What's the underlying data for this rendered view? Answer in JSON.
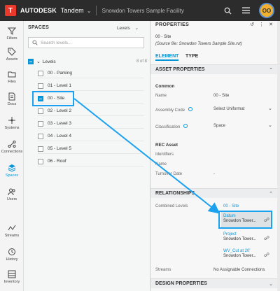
{
  "header": {
    "logo_letter": "T",
    "brand": "AUTODESK",
    "product": "Tandem",
    "facility": "Snowdon Towers Sample Facility",
    "avatar_initials": "OO",
    "icons": [
      "search-icon",
      "menu-icon"
    ]
  },
  "rail": {
    "items": [
      {
        "label": "Filters",
        "icon": "filter-icon"
      },
      {
        "label": "Assets",
        "icon": "tag-icon"
      },
      {
        "label": "Files",
        "icon": "file-icon"
      },
      {
        "label": "Docs",
        "icon": "document-icon"
      },
      {
        "label": "Systems",
        "icon": "systems-icon"
      },
      {
        "label": "Connections",
        "icon": "connections-icon"
      },
      {
        "label": "Spaces",
        "icon": "spaces-icon"
      },
      {
        "label": "Users",
        "icon": "users-icon"
      },
      {
        "label": "Streams",
        "icon": "streams-icon"
      },
      {
        "label": "History",
        "icon": "history-icon"
      },
      {
        "label": "Inventory",
        "icon": "inventory-icon"
      }
    ]
  },
  "spaces": {
    "title": "SPACES",
    "filter_label": "Levels",
    "search_placeholder": "Search levels...",
    "levels_header": "Levels",
    "levels_count": "8 of 8",
    "levels": [
      "00 - Parking",
      "01 - Level 1",
      "00 - Site",
      "02 - Level 2",
      "03 - Level 3",
      "04 - Level 4",
      "05 - Level 5",
      "06 - Roof"
    ]
  },
  "properties": {
    "title": "PROPERTIES",
    "name": "00 - Site",
    "source": "(Source file: Snowdon Towers Sample Site.rvt)",
    "tabs": [
      "ELEMENT",
      "TYPE"
    ],
    "asset_section": "ASSET PROPERTIES",
    "common_group": "Common",
    "name_label": "Name",
    "name_value": "00 - Site",
    "assembly_label": "Assembly Code",
    "assembly_value": "Select Uniformat",
    "classification_label": "Classification",
    "classification_value": "Space",
    "rec_group": "REC Asset",
    "identifiers_label": "Identifiers",
    "rec_name_label": "Name",
    "turnover_label": "Turnover Date",
    "turnover_value": "-",
    "relationships_section": "RELATIONSHIPS",
    "combined_label": "Combined Levels",
    "combined_value": "00 - Site",
    "rel_items": [
      {
        "name": "Datum",
        "value": "Snowdon Tower..."
      },
      {
        "name": "Project",
        "value": "Snowdon Tower..."
      },
      {
        "name": "WV_Cut at 20'",
        "value": "Snowdon Tower..."
      }
    ],
    "streams_label": "Streams",
    "streams_value": "No Assignable Connections",
    "design_section": "DESIGN PROPERTIES"
  },
  "colors": {
    "accent": "#0696d7",
    "annotation": "#1aa1f0",
    "logo": "#e8392a"
  }
}
